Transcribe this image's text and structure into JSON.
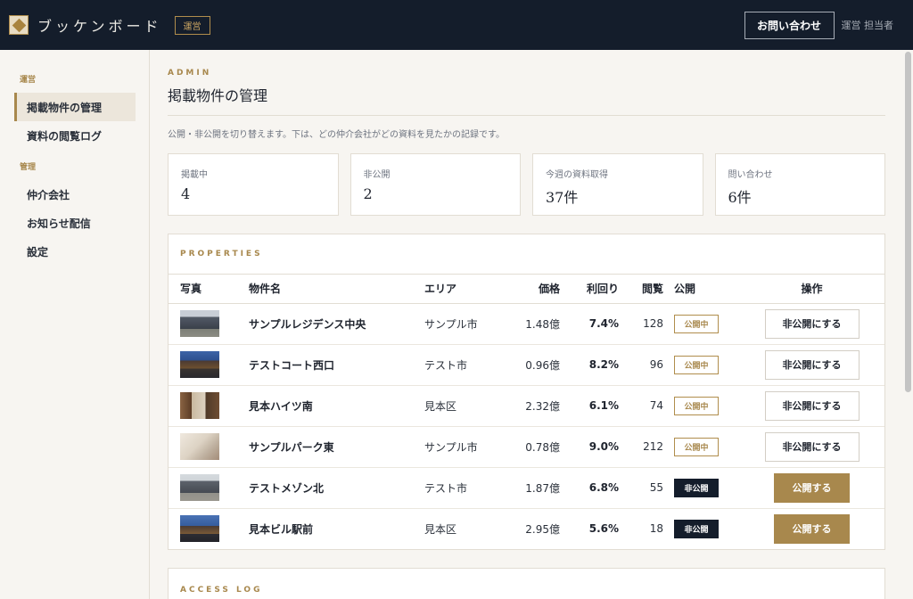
{
  "header": {
    "brand": "ブッケンボード",
    "role_badge": "運営",
    "contact_button": "お問い合わせ",
    "user": "運営 担当者"
  },
  "sidebar": {
    "groups": [
      {
        "label": "運営",
        "items": [
          {
            "label": "掲載物件の管理",
            "active": true
          },
          {
            "label": "資料の閲覧ログ"
          }
        ]
      },
      {
        "label": "管理",
        "items": [
          {
            "label": "仲介会社"
          },
          {
            "label": "お知らせ配信"
          },
          {
            "label": "設定"
          }
        ]
      }
    ]
  },
  "main": {
    "eyebrow": "ADMIN",
    "title": "掲載物件の管理",
    "description": "公開・非公開を切り替えます。下は、どの仲介会社がどの資料を見たかの記録です。",
    "stats": [
      {
        "label": "掲載中",
        "value": "4"
      },
      {
        "label": "非公開",
        "value": "2"
      },
      {
        "label": "今週の資料取得",
        "value": "37件"
      },
      {
        "label": "問い合わせ",
        "value": "6件"
      }
    ]
  },
  "properties": {
    "heading": "PROPERTIES",
    "columns": [
      "写真",
      "物件名",
      "エリア",
      "価格",
      "利回り",
      "閲覧",
      "公開",
      "操作"
    ],
    "rows": [
      {
        "name": "サンプルレジデンス中央",
        "area": "サンプル市",
        "price": "1.48億",
        "yield": "7.4%",
        "views": "128",
        "status": "公開中",
        "action": "非公開にする"
      },
      {
        "name": "テストコート西口",
        "area": "テスト市",
        "price": "0.96億",
        "yield": "8.2%",
        "views": "96",
        "status": "公開中",
        "action": "非公開にする"
      },
      {
        "name": "見本ハイツ南",
        "area": "見本区",
        "price": "2.32億",
        "yield": "6.1%",
        "views": "74",
        "status": "公開中",
        "action": "非公開にする"
      },
      {
        "name": "サンプルパーク東",
        "area": "サンプル市",
        "price": "0.78億",
        "yield": "9.0%",
        "views": "212",
        "status": "公開中",
        "action": "非公開にする"
      },
      {
        "name": "テストメゾン北",
        "area": "テスト市",
        "price": "1.87億",
        "yield": "6.8%",
        "views": "55",
        "status": "非公開",
        "action": "公開する"
      },
      {
        "name": "見本ビル駅前",
        "area": "見本区",
        "price": "2.95億",
        "yield": "5.6%",
        "views": "18",
        "status": "非公開",
        "action": "公開する"
      }
    ]
  },
  "access_log": {
    "heading": "ACCESS LOG"
  },
  "colors": {
    "header_bg": "#141d2b",
    "accent": "#a8884d",
    "page_bg": "#f7f5f1"
  },
  "icons": {
    "logo": "diamond-logo-icon"
  }
}
